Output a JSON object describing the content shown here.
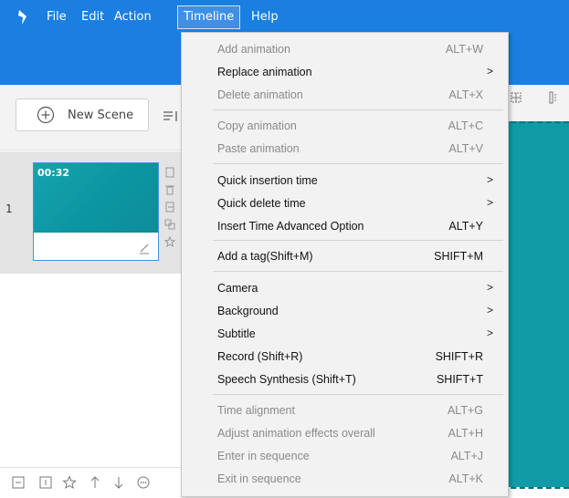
{
  "menubar": {
    "logo_icon": "app-logo-icon",
    "items": [
      {
        "label": "File"
      },
      {
        "label": "Edit"
      },
      {
        "label": "Action"
      },
      {
        "label": "Timeline"
      },
      {
        "label": "Help"
      }
    ],
    "active_item": "Timeline",
    "bar_color": "#1a7fe0"
  },
  "toolbar": {
    "new_scene_label": "New Scene",
    "new_scene_icon": "plus-circle-icon"
  },
  "scene_panel": {
    "scenes": [
      {
        "index": "1",
        "duration": "00:32"
      }
    ],
    "thumbnail_color": "#0f9aa6"
  },
  "timeline_menu": {
    "items": [
      {
        "label": "Add animation",
        "shortcut": "ALT+W",
        "submenu": false,
        "enabled": false
      },
      {
        "label": "Replace animation",
        "shortcut": "",
        "submenu": true,
        "enabled": true
      },
      {
        "label": "Delete animation",
        "shortcut": "ALT+X",
        "submenu": false,
        "enabled": false
      },
      {
        "label": "Copy animation",
        "shortcut": "ALT+C",
        "submenu": false,
        "enabled": false
      },
      {
        "label": "Paste animation",
        "shortcut": "ALT+V",
        "submenu": false,
        "enabled": false
      },
      {
        "label": "Quick insertion time",
        "shortcut": "",
        "submenu": true,
        "enabled": true
      },
      {
        "label": "Quick delete time",
        "shortcut": "",
        "submenu": true,
        "enabled": true
      },
      {
        "label": "Insert Time Advanced Option",
        "shortcut": "ALT+Y",
        "submenu": false,
        "enabled": true
      },
      {
        "label": "Add a tag(Shift+M)",
        "shortcut": "SHIFT+M",
        "submenu": false,
        "enabled": true
      },
      {
        "label": "Camera",
        "shortcut": "",
        "submenu": true,
        "enabled": true
      },
      {
        "label": "Background",
        "shortcut": "",
        "submenu": true,
        "enabled": true
      },
      {
        "label": "Subtitle",
        "shortcut": "",
        "submenu": true,
        "enabled": true
      },
      {
        "label": "Record (Shift+R)",
        "shortcut": "SHIFT+R",
        "submenu": false,
        "enabled": true
      },
      {
        "label": "Speech Synthesis (Shift+T)",
        "shortcut": "SHIFT+T",
        "submenu": false,
        "enabled": true
      },
      {
        "label": "Time alignment",
        "shortcut": "ALT+G",
        "submenu": false,
        "enabled": false
      },
      {
        "label": "Adjust animation effects overall",
        "shortcut": "ALT+H",
        "submenu": false,
        "enabled": false
      },
      {
        "label": "Enter in sequence",
        "shortcut": "ALT+J",
        "submenu": false,
        "enabled": false
      },
      {
        "label": "Exit in sequence",
        "shortcut": "ALT+K",
        "submenu": false,
        "enabled": false
      }
    ],
    "submenu_arrow": ">"
  }
}
